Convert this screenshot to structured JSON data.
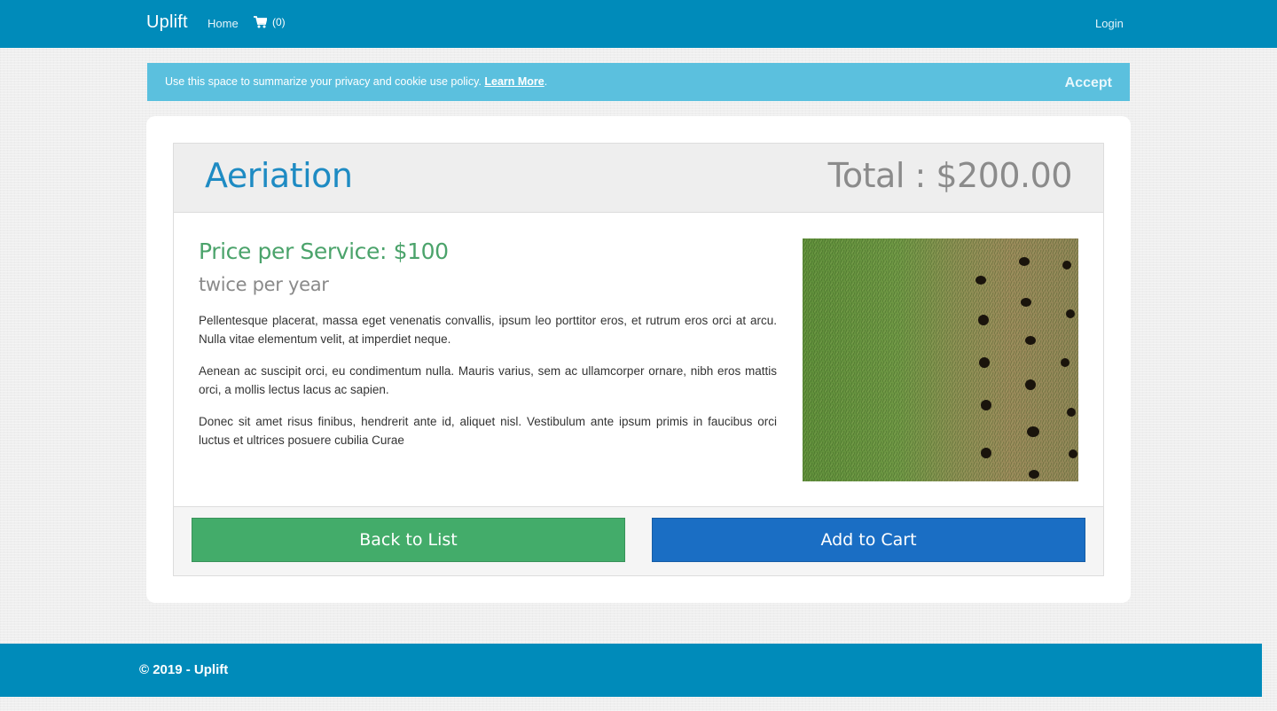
{
  "navbar": {
    "brand": "Uplift",
    "home": "Home",
    "cart_count": "(0)",
    "login": "Login",
    "cart_icon": "shopping-cart-icon"
  },
  "cookie": {
    "text": "Use this space to summarize your privacy and cookie use policy.",
    "learn_more": "Learn More",
    "period": ".",
    "accept": "Accept"
  },
  "service": {
    "title": "Aeriation",
    "total": "Total : $200.00",
    "price": "Price per Service: $100",
    "frequency": "twice per year",
    "paragraphs": [
      "Pellentesque placerat, massa eget venenatis convallis, ipsum leo porttitor eros, et rutrum eros orci at arcu. Nulla vitae elementum velit, at imperdiet neque.",
      "Aenean ac suscipit orci, eu condimentum nulla. Mauris varius, sem ac ullamcorper ornare, nibh eros mattis orci, a mollis lectus lacus ac sapien.",
      "Donec sit amet risus finibus, hendrerit ante id, aliquet nisl. Vestibulum ante ipsum primis in faucibus orci luctus et ultrices posuere cubilia Curae"
    ]
  },
  "actions": {
    "back": "Back to List",
    "add": "Add to Cart"
  },
  "footer": {
    "copyright": "© 2019 - Uplift"
  },
  "colors": {
    "navbar": "#008bba",
    "cookie": "#5bc0de",
    "title": "#1e8bc3",
    "price": "#4ba36b",
    "back_button": "#43ac6a",
    "cart_button": "#1a6ec4"
  }
}
